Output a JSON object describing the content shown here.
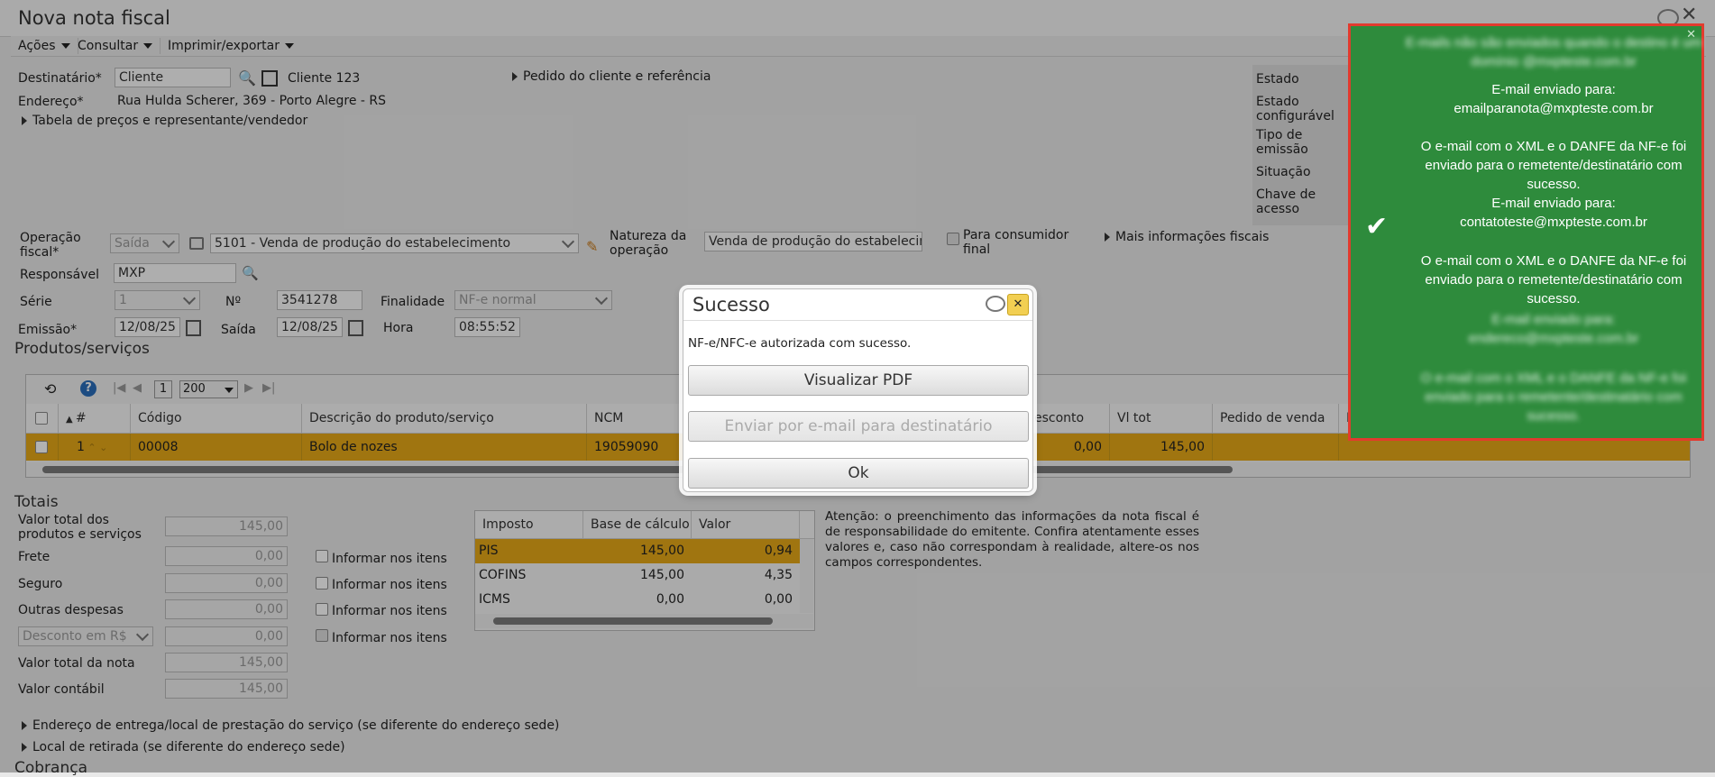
{
  "window": {
    "title": "Nova nota fiscal"
  },
  "menu": {
    "acoes": "Ações",
    "consultar": "Consultar",
    "imprimir": "Imprimir/exportar"
  },
  "header": {
    "destinatario_label": "Destinatário*",
    "destinatario_placeholder": "Cliente",
    "destinatario_name": "Cliente 123",
    "pedido_link": "Pedido do cliente e referência",
    "endereco_label": "Endereço*",
    "endereco_value": "Rua Hulda Scherer, 369 - Porto Alegre - RS",
    "tabela_precos": "Tabela de preços e representante/vendedor"
  },
  "status_panel": {
    "estado": "Estado",
    "estado_configuravel": "Estado configurável",
    "tipo_emissao": "Tipo de emissão",
    "situacao": "Situação",
    "chave_acesso": "Chave de acesso"
  },
  "form": {
    "operacao_label": "Operação fiscal*",
    "operacao_select": "Saída",
    "operacao_value": "5101 - Venda de produção do estabelecimento",
    "natureza_label": "Natureza da operação",
    "natureza_value": "Venda de produção do estabelecim",
    "consumidor_final": "Para consumidor final",
    "mais_info": "Mais informações fiscais",
    "responsavel_label": "Responsável",
    "responsavel_value": "MXP",
    "serie_label": "Série",
    "serie_value": "1",
    "numero_label": "Nº",
    "numero_value": "3541278",
    "finalidade_label": "Finalidade",
    "finalidade_value": "NF-e normal",
    "emissao_label": "Emissão*",
    "emissao_value": "12/08/25",
    "saida_label": "Saída",
    "saida_value": "12/08/25",
    "hora_label": "Hora",
    "hora_value": "08:55:52"
  },
  "produtos": {
    "title": "Produtos/serviços",
    "page": "1",
    "page_size": "200",
    "columns": [
      "#",
      "Código",
      "Descrição do produto/serviço",
      "NCM",
      "esconto",
      "Vl tot",
      "Pedido de venda",
      "E"
    ],
    "row": {
      "num": "1",
      "codigo": "00008",
      "descricao": "Bolo de nozes",
      "ncm": "19059090",
      "desconto": "0,00",
      "vl_tot": "145,00"
    }
  },
  "totais": {
    "title": "Totais",
    "valor_total_produtos_label": "Valor total dos produtos e serviços",
    "valor_total_produtos": "145,00",
    "frete_label": "Frete",
    "frete": "0,00",
    "seguro_label": "Seguro",
    "seguro": "0,00",
    "outras_label": "Outras despesas",
    "outras": "0,00",
    "desconto_select": "Desconto em R$",
    "desconto": "0,00",
    "valor_nota_label": "Valor total da nota",
    "valor_nota": "145,00",
    "valor_contabil_label": "Valor contábil",
    "valor_contabil": "145,00",
    "informar": "Informar nos itens"
  },
  "impostos": {
    "headers": [
      "Imposto",
      "Base de cálculo",
      "Valor"
    ],
    "rows": [
      {
        "imposto": "PIS",
        "base": "145,00",
        "valor": "0,94"
      },
      {
        "imposto": "COFINS",
        "base": "145,00",
        "valor": "4,35"
      },
      {
        "imposto": "ICMS",
        "base": "0,00",
        "valor": "0,00"
      }
    ]
  },
  "aviso": "Atenção: o preenchimento das informações da nota fiscal é de responsabilidade do emitente. Confira atentamente esses valores e, caso não correspondam à realidade, altere-os nos campos correspondentes.",
  "links": {
    "endereco_entrega": "Endereço de entrega/local de prestação do serviço (se diferente do endereço sede)",
    "local_retirada": "Local de retirada (se diferente do endereço sede)",
    "cobranca": "Cobrança"
  },
  "modal": {
    "title": "Sucesso",
    "message": "NF-e/NFC-e autorizada com sucesso.",
    "btn_pdf": "Visualizar PDF",
    "btn_email": "Enviar por e-mail para destinatário",
    "btn_ok": "Ok"
  },
  "toast": {
    "blur_top": "E-mails não são enviados quando o destino é um domínio @mxpteste.com.br",
    "msg1_title": "E-mail enviado para:",
    "msg1_email": "emailparanota@mxpteste.com.br",
    "msg1_body": "O e-mail com o XML e o DANFE da NF-e foi enviado para o remetente/destinatário com sucesso.",
    "msg2_title": "E-mail enviado para:",
    "msg2_email": "contatoteste@mxpteste.com.br",
    "msg2_body": "O e-mail com o XML e o DANFE da NF-e foi enviado para o remetente/destinatário com sucesso.",
    "blur_bottom1": "E-mail enviado para: endereco@mxpteste.com.br",
    "blur_bottom2": "O e-mail com o XML e o DANFE da NF-e foi enviado para o remetente/destinatário com sucesso."
  },
  "colors": {
    "toast_bg": "#2e8b3c",
    "toast_border": "#e23b2e",
    "row_highlight": "#e6a817"
  }
}
